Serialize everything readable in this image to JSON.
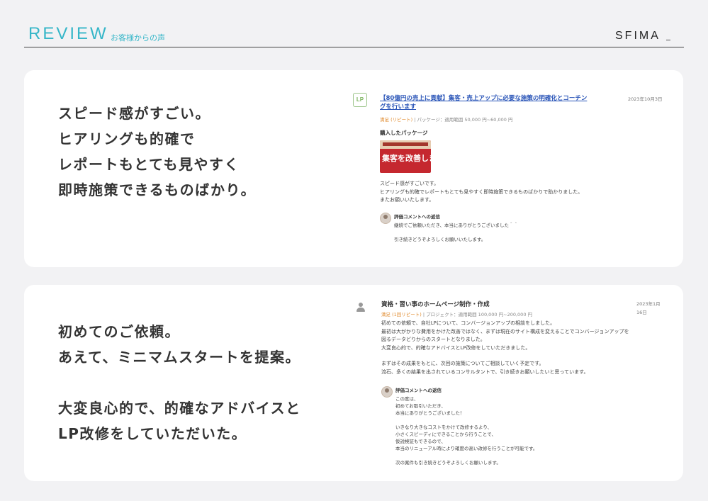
{
  "header": {
    "title": "REVIEW",
    "subtitle": "お客様からの声",
    "brand": "SFIMA"
  },
  "reviews": [
    {
      "headline": [
        "スピード感がすごい。",
        "ヒアリングも的確で",
        "レポートもとても見やすく",
        "即時施策できるものばかり。"
      ],
      "logo_text": "LP",
      "listing_title": "【80億円の売上に貢献】集客・売上アップに必要な施策の明確化とコーチングを行います",
      "date": "2023年10月3日",
      "badge": "満足 (リピート)",
      "meta": "| パッケージ：適用範囲 50,000 円~60,000 円",
      "package_label": "購入したパッケージ",
      "package_image_text": "集客を改善します",
      "body": [
        "スピード感がすごいです。",
        "ヒアリングも的確でレポートもとても見やすく即時施策できるものばかりで助かりました。",
        "またお願いいたします。"
      ],
      "reply_label": "評価コメントへの返信",
      "reply_body": [
        "継続でご依頼いただき、本当にありがとうございました＾＾",
        "",
        "引き続きどうぞよろしくお願いいたします。"
      ]
    },
    {
      "headline": [
        "初めてのご依頼。",
        "あえて、ミニマムスタートを提案。",
        "",
        "大変良心的で、的確なアドバイスと",
        "LP改修をしていただいた。"
      ],
      "listing_title": "資格・習い事のホームページ制作・作成",
      "date": "2023年1月16日",
      "badge": "満足 (1回リピート)",
      "meta": "| プロジェクト：適用範囲 100,000 円~200,000 円",
      "body": [
        "初めての依頼で、自社LPについて、コンバージョンアップの相談をしました。",
        "最初は大がかりな費用をかけた改善ではなく、まずは現在のサイト構成を変えることでコンバージョンアップを",
        "図るデータどりからのスタートとなりました。",
        "大変良心的で、的確なアドバイスとLP改修をしていただきました。",
        "",
        "まずはその成果をもとに、次回の施策についてご相談していく予定です。",
        "流石、多くの結果を出されているコンサルタントで、引き続きお願いしたいと思っています。"
      ],
      "reply_label": "評価コメントへの返信",
      "reply_body": [
        "この度は、",
        "初めてお取引いただき、",
        "本当にありがとうございました！",
        "",
        "いきなり大きなコストをかけて改修するより、",
        "小さくスピーディにできることから行うことで、",
        "仮説検証もできるので、",
        "本当のリニューアル時により確度の高い改修を行うことが可能です。",
        "",
        "次の案件も引き続きどうぞよろしくお願いします。"
      ]
    }
  ]
}
